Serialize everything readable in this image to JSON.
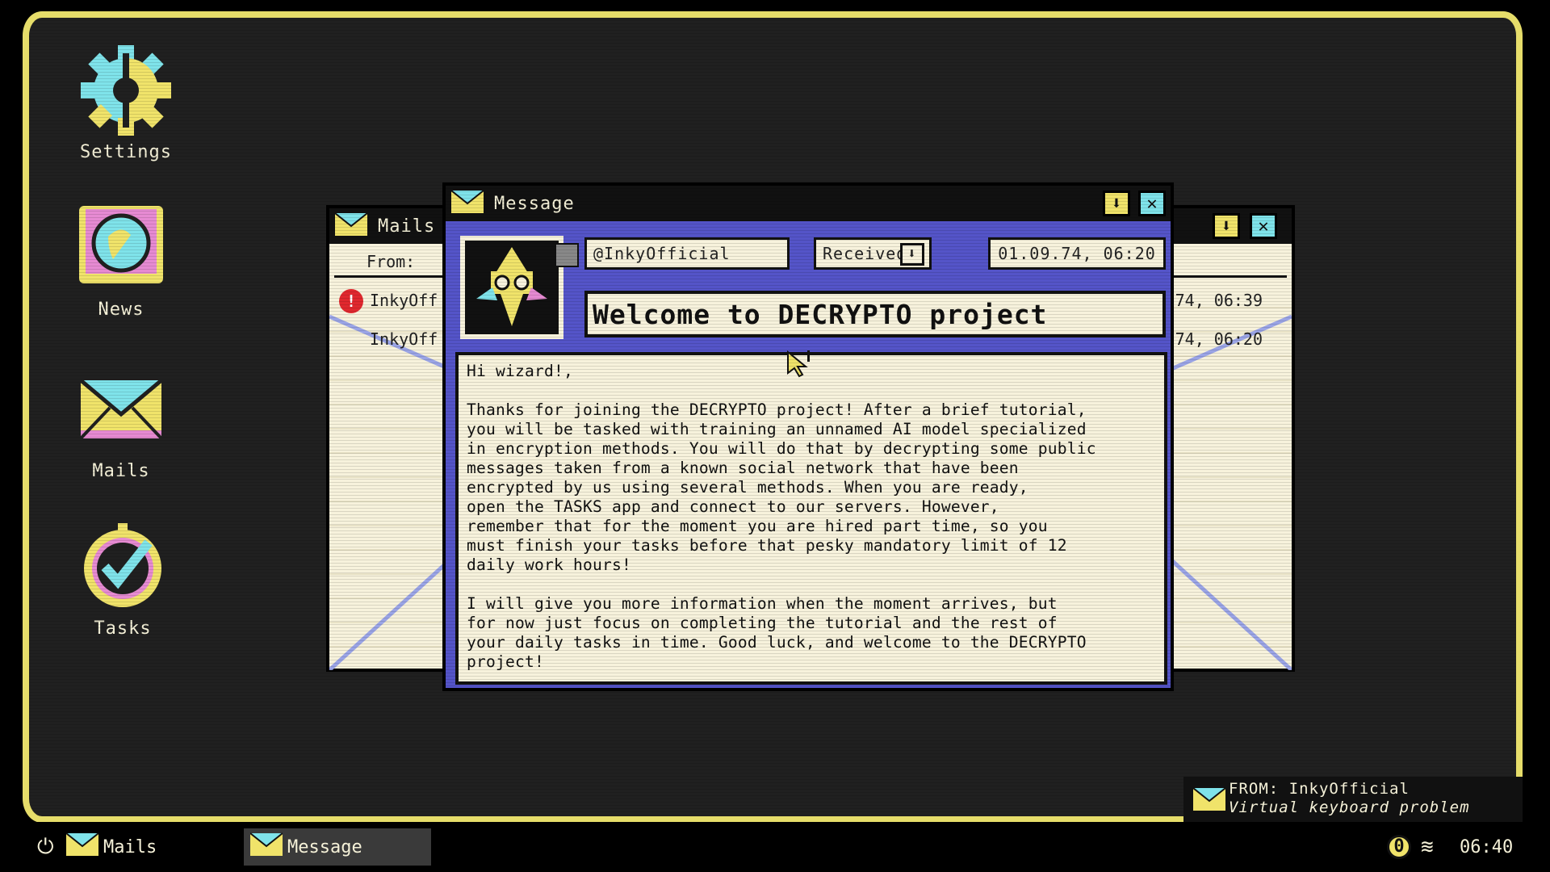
{
  "desktop": {
    "icons": [
      {
        "label": "Settings"
      },
      {
        "label": "News"
      },
      {
        "label": "Mails"
      },
      {
        "label": "Tasks"
      }
    ]
  },
  "mails_window": {
    "title": "Mails",
    "from_header": "From:",
    "rows": [
      {
        "sender": "InkyOff",
        "date": "74, 06:39"
      },
      {
        "sender": "InkyOff",
        "date": "74, 06:20"
      }
    ]
  },
  "message_window": {
    "title": "Message",
    "sender": "@InkyOfficial",
    "status": "Received",
    "datetime": "01.09.74, 06:20",
    "subject": "Welcome to DECRYPTO project",
    "body": "Hi wizard!,\n\nThanks for joining the DECRYPTO project! After a brief tutorial,\nyou will be tasked with training an unnamed AI model specialized\nin encryption methods. You will do that by decrypting some public\nmessages taken from a known social network that have been\nencrypted by us using several methods. When you are ready,\nopen the TASKS app and connect to our servers. However,\nremember that for the moment you are hired part time, so you\nmust finish your tasks before that pesky mandatory limit of 12\ndaily work hours!\n\nI will give you more information when the moment arrives, but\nfor now just focus on completing the tutorial and the rest of\nyour daily tasks in time. Good luck, and welcome to the DECRYPTO\nproject!"
  },
  "notification": {
    "line1": "FROM: InkyOfficial",
    "line2": "Virtual keyboard problem"
  },
  "taskbar": {
    "items": [
      {
        "label": "Mails"
      },
      {
        "label": "Message"
      }
    ],
    "clock": "06:40"
  },
  "colors": {
    "frame": "#e6dd6a",
    "accent_blue": "#5454c8",
    "paper": "#f7f2dc",
    "cyan": "#7fe3ea",
    "yellow": "#f0e36a",
    "pink": "#e68ad2"
  }
}
